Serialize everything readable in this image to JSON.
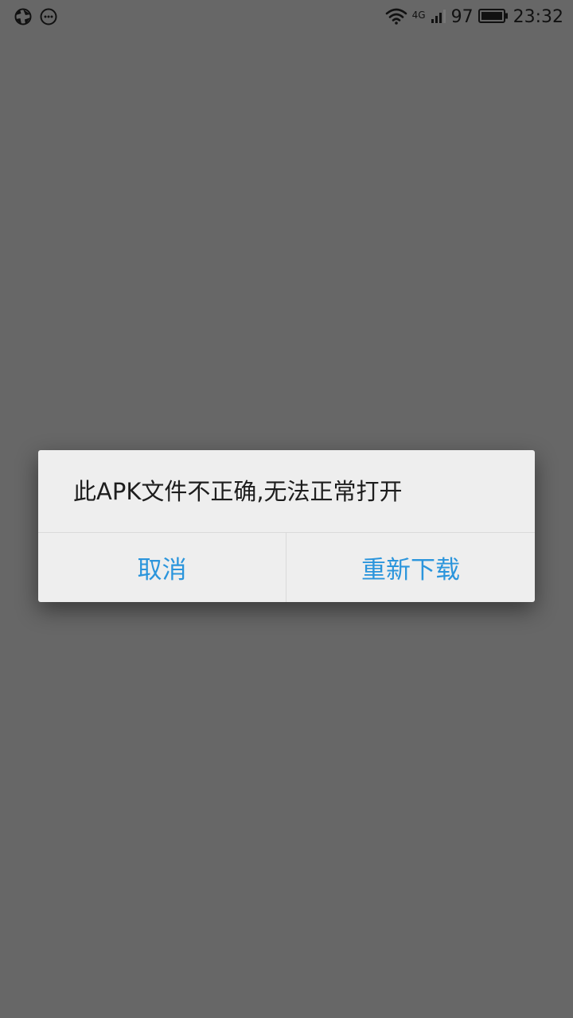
{
  "status_bar": {
    "left_icons": [
      "aperture-icon",
      "chat-bubble-icon"
    ],
    "network_type": "4G",
    "battery_level": "97",
    "time": "23:32"
  },
  "dialog": {
    "message": "此APK文件不正确,无法正常打开",
    "cancel_label": "取消",
    "redownload_label": "重新下载",
    "accent_color": "#2b95dc"
  }
}
